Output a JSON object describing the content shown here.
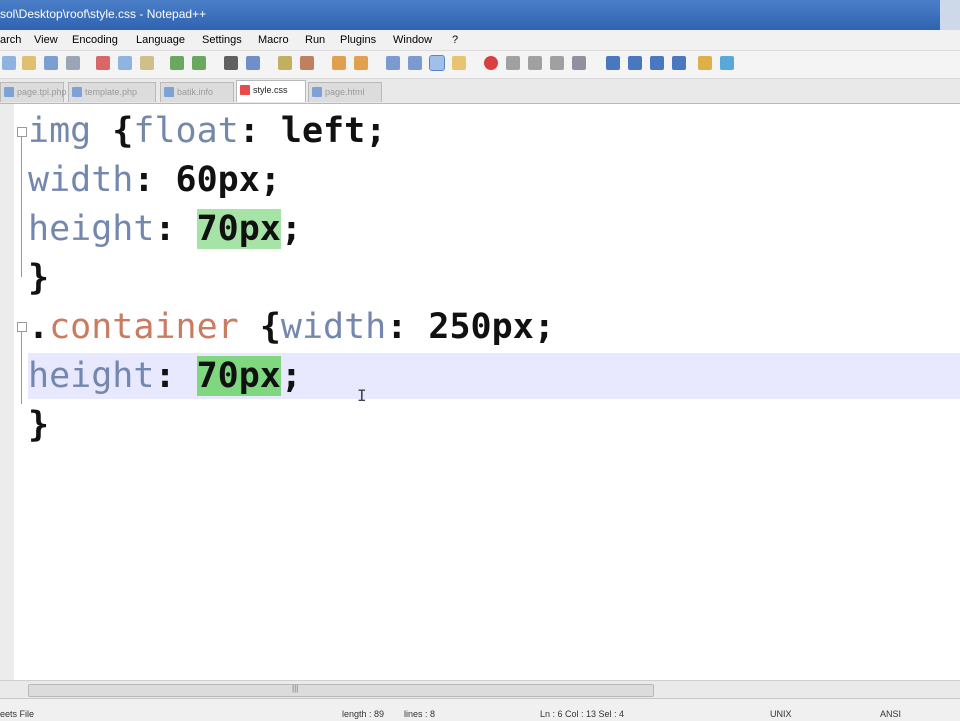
{
  "window": {
    "title": "sol\\Desktop\\roof\\style.css - Notepad++"
  },
  "menu": {
    "items": [
      "arch",
      "View",
      "Encoding",
      "Language",
      "Settings",
      "Macro",
      "Run",
      "Plugins",
      "Window",
      "?"
    ]
  },
  "tabs": [
    {
      "label": "page.tpl.php",
      "active": false
    },
    {
      "label": "template.php",
      "active": false
    },
    {
      "label": "batik.info",
      "active": false
    },
    {
      "label": "style.css",
      "active": true
    },
    {
      "label": "page.html",
      "active": false
    }
  ],
  "editor": {
    "code_lines": [
      "img {float: left;",
      "width: 60px;",
      "height: 70px;",
      "}",
      ".container {width: 250px;",
      "height: 70px;",
      "}"
    ],
    "current_line": 6,
    "text_cursor_glyph": "I",
    "accent_current_line": "#e8e8ff",
    "highlight_color": "#a6e3a6"
  },
  "statusbar": {
    "file_type": "eets File",
    "length": "length : 89",
    "lines": "lines : 8",
    "position": "Ln : 6   Col : 13   Sel : 4",
    "eol": "UNIX",
    "encoding": "ANSI"
  }
}
